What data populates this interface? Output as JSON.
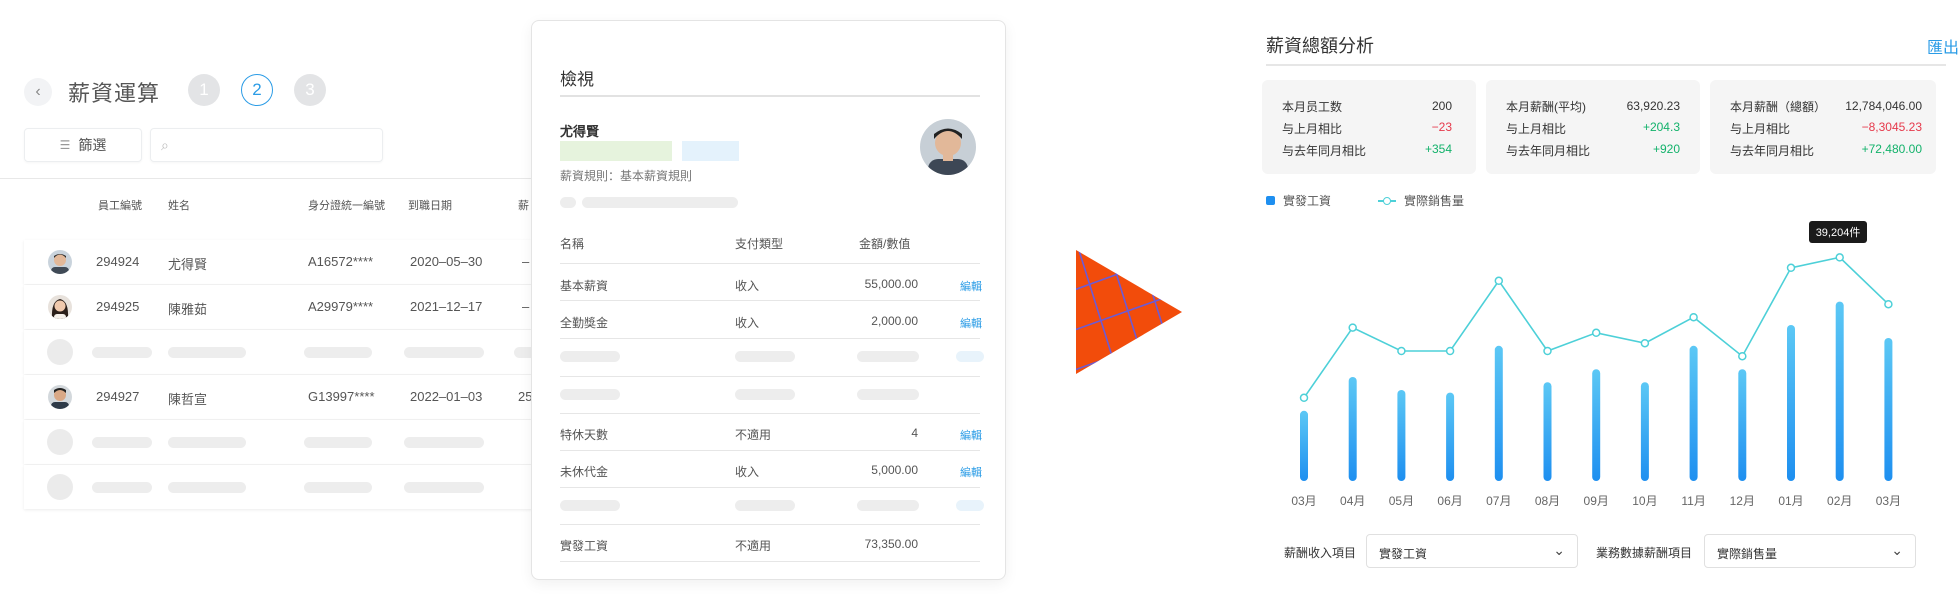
{
  "payroll": {
    "title": "薪資運算",
    "steps": [
      "1",
      "2",
      "3"
    ],
    "active_step": "2",
    "filter_label": "篩選",
    "search_placeholder": "",
    "headers": [
      "員工編號",
      "姓名",
      "身分證統一編號",
      "到職日期",
      "薪"
    ],
    "rows": [
      {
        "id": "294924",
        "name": "尤得賢",
        "national_id": "A16572****",
        "start_date": "2020–05–30",
        "extra": "–"
      },
      {
        "id": "294925",
        "name": "陳雅茹",
        "national_id": "A29979****",
        "start_date": "2021–12–17",
        "extra": "–"
      },
      {
        "id": "294927",
        "name": "陳哲宣",
        "national_id": "G13997****",
        "start_date": "2022–01–03",
        "extra": "25"
      }
    ]
  },
  "modal": {
    "title": "檢視",
    "employee_name": "尤得賢",
    "rule": "薪資規則：基本薪資規則",
    "headers": [
      "名稱",
      "支付類型",
      "金額/數值"
    ],
    "rows": [
      {
        "name": "基本薪資",
        "type": "收入",
        "amount": "55,000.00",
        "edit": "編輯"
      },
      {
        "name": "全勤獎金",
        "type": "收入",
        "amount": "2,000.00",
        "edit": "編輯"
      },
      {
        "name": "特休天數",
        "type": "不適用",
        "amount": "4",
        "edit": "編輯"
      },
      {
        "name": "未休代金",
        "type": "收入",
        "amount": "5,000.00",
        "edit": "編輯"
      },
      {
        "name": "實發工資",
        "type": "不適用",
        "amount": "73,350.00",
        "edit": ""
      }
    ]
  },
  "analysis": {
    "title": "薪資總額分析",
    "export_label": "匯出",
    "cards": [
      {
        "rows": [
          {
            "label": "本月员工数",
            "value": "200",
            "tone": ""
          },
          {
            "label": "与上月相比",
            "value": "−23",
            "tone": "neg"
          },
          {
            "label": "与去年同月相比",
            "value": "+354",
            "tone": "pos"
          }
        ]
      },
      {
        "rows": [
          {
            "label": "本月薪酬(平均)",
            "value": "63,920.23",
            "tone": ""
          },
          {
            "label": "与上月相比",
            "value": "+204.3",
            "tone": "pos"
          },
          {
            "label": "与去年同月相比",
            "value": "+920",
            "tone": "pos"
          }
        ]
      },
      {
        "rows": [
          {
            "label": "本月薪酬（總額）",
            "value": "12,784,046.00",
            "tone": ""
          },
          {
            "label": "与上月相比",
            "value": "−8,3045.23",
            "tone": "neg"
          },
          {
            "label": "与去年同月相比",
            "value": "+72,480.00",
            "tone": "pos"
          }
        ]
      }
    ],
    "legend_bar": "實發工資",
    "legend_line": "實際銷售量",
    "tooltip": "39,204件",
    "income_label": "薪酬收入項目",
    "income_value": "實發工資",
    "business_label": "業務數據薪酬項目",
    "business_value": "實際銷售量"
  },
  "chart_data": {
    "type": "bar",
    "categories": [
      "03月",
      "04月",
      "05月",
      "06月",
      "07月",
      "08月",
      "09月",
      "10月",
      "11月",
      "12月",
      "01月",
      "02月",
      "03月"
    ],
    "series": [
      {
        "name": "實發工資",
        "type": "bar",
        "values": [
          27,
          40,
          35,
          34,
          52,
          38,
          43,
          38,
          52,
          43,
          60,
          69,
          55
        ]
      },
      {
        "name": "實際銷售量",
        "type": "line",
        "values": [
          32,
          59,
          50,
          50,
          77,
          50,
          57,
          53,
          63,
          48,
          82,
          86,
          68
        ]
      }
    ],
    "tooltip_index": 11,
    "ylim": [
      0,
      100
    ],
    "grid": false,
    "legend": "top-left",
    "colors": {
      "bar": "#1e8ff0",
      "line": "#4dd0d8"
    }
  },
  "colors": {
    "accent": "#2b9ce6",
    "positive": "#13b26b",
    "negative": "#e6394b",
    "arrow": "#f24c0b",
    "arrow_grid": "#6b5bd6"
  }
}
